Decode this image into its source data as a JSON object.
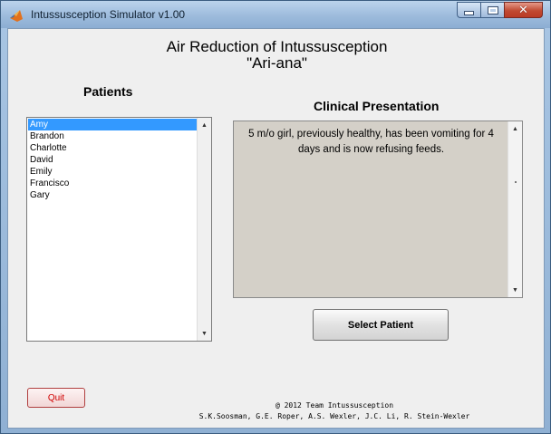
{
  "window": {
    "title": "Intussusception Simulator v1.00",
    "icon": "matlab-icon",
    "controls": [
      "minimize-icon",
      "maximize-icon",
      "close-icon"
    ]
  },
  "header": {
    "title": "Air Reduction of Intussusception",
    "subtitle": "\"Ari-ana\""
  },
  "patients": {
    "label": "Patients",
    "items": [
      "Amy",
      "Brandon",
      "Charlotte",
      "David",
      "Emily",
      "Francisco",
      "Gary"
    ],
    "selected": "Amy"
  },
  "clinical": {
    "label": "Clinical Presentation",
    "text": "5 m/o girl, previously healthy, has been vomiting for 4 days and is now refusing feeds."
  },
  "buttons": {
    "select_patient": "Select Patient",
    "quit": "Quit"
  },
  "footer": {
    "line1": "@ 2012 Team Intussusception",
    "line2": "S.K.Soosman, G.E. Roper, A.S. Wexler, J.C. Li, R. Stein-Wexler"
  },
  "colors": {
    "selection": "#3399ff",
    "quit_text": "#d00000",
    "textbox_bg": "#d4d0c8"
  }
}
